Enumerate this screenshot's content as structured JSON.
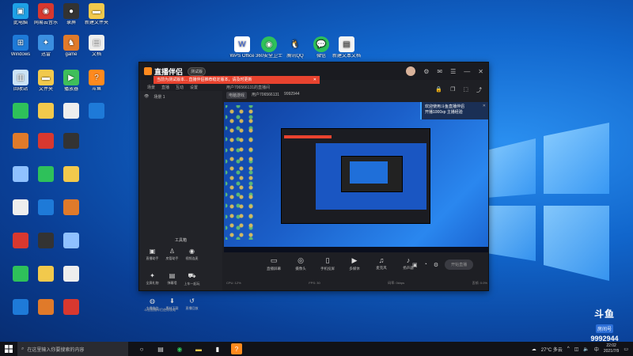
{
  "desktop_icons": [
    {
      "label": "此电脑",
      "color": "#1ea1e6",
      "glyph": "▣",
      "pos": "a"
    },
    {
      "label": "网易云音乐",
      "color": "#d8382f",
      "glyph": "◉",
      "pos": "b"
    },
    {
      "label": "录屏",
      "color": "#333",
      "glyph": "●",
      "pos": "c"
    },
    {
      "label": "新建文件夹",
      "color": "#f2c94c",
      "glyph": "▬",
      "pos": "d"
    },
    {
      "label": "Windows",
      "color": "#1e7ad8",
      "glyph": "⊞",
      "pos": "e"
    },
    {
      "label": "迅雷",
      "color": "#3b8fe0",
      "glyph": "✦",
      "pos": "f"
    },
    {
      "label": "game",
      "color": "#e07a2a",
      "glyph": "♞",
      "pos": "g"
    },
    {
      "label": "文档",
      "color": "#eee",
      "glyph": "▤",
      "pos": "h"
    },
    {
      "label": "回收站",
      "color": "#cce3f5",
      "glyph": "▥",
      "pos": "i"
    },
    {
      "label": "文件夹",
      "color": "#f2c94c",
      "glyph": "▬",
      "pos": "j"
    },
    {
      "label": "播放器",
      "color": "#3fbf5a",
      "glyph": "▶",
      "pos": "k"
    },
    {
      "label": "斗鱼",
      "color": "#ff8a1e",
      "glyph": "?",
      "pos": "l"
    }
  ],
  "app": {
    "brand": "直播伴侣",
    "beta_label": "测试版",
    "notice": "当前为测试版本... 直播伴侣推荐稳定版本，请及时更新",
    "tabs": [
      "场景",
      "直播",
      "互动",
      "设置"
    ],
    "room_info": "用户706566131的直播间",
    "scene_label": "场景 1",
    "room_tag_badge": "电脑游戏",
    "room_tag_extra": "用户706566131",
    "room_number": "9992944",
    "tool_title": "工具箱",
    "tools": [
      {
        "label": "直播助手",
        "icon": "display-icon"
      },
      {
        "label": "房管助手",
        "icon": "person-icon"
      },
      {
        "label": "视频连麦",
        "icon": "camera-icon"
      },
      {
        "label": "",
        "icon": "blank-icon"
      },
      {
        "label": "全屏礼物",
        "icon": "gift-icon"
      },
      {
        "label": "弹幕墙",
        "icon": "message-icon"
      },
      {
        "label": "上车一起玩",
        "icon": "car-icon"
      },
      {
        "label": "",
        "icon": "blank-icon"
      },
      {
        "label": "主播微信",
        "icon": "wechat-icon"
      },
      {
        "label": "素材下载",
        "icon": "download-icon"
      },
      {
        "label": "直播回放",
        "icon": "replay-icon"
      },
      {
        "label": "",
        "icon": "blank-icon"
      }
    ],
    "left_bottom": "斗鱼直播伴侣使用攻略",
    "popup": {
      "line1": "欢迎使用斗鱼直播伴侣",
      "line2": "开播1000xp 主播经验"
    },
    "controls": [
      {
        "label": "直播屏幕",
        "glyph": "▭"
      },
      {
        "label": "摄像头",
        "glyph": "◎"
      },
      {
        "label": "手机投屏",
        "glyph": "▯"
      },
      {
        "label": "多媒体",
        "glyph": "▶"
      },
      {
        "label": "麦克风",
        "glyph": "♫"
      },
      {
        "label": "扬声器",
        "glyph": "♪"
      }
    ],
    "start_label": "开始直播",
    "status": [
      "CPU: 12%",
      "FPS: 30",
      "码率: 0kbps",
      "丢帧: 0.0%"
    ]
  },
  "watermark": {
    "logo": "斗鱼",
    "tag": "房间号",
    "number": "9992944"
  },
  "taskbar": {
    "search_placeholder": "在这里输入你要搜索的内容",
    "weather": "27°C 多云",
    "time": "22:02",
    "date": "2021/7/9"
  }
}
